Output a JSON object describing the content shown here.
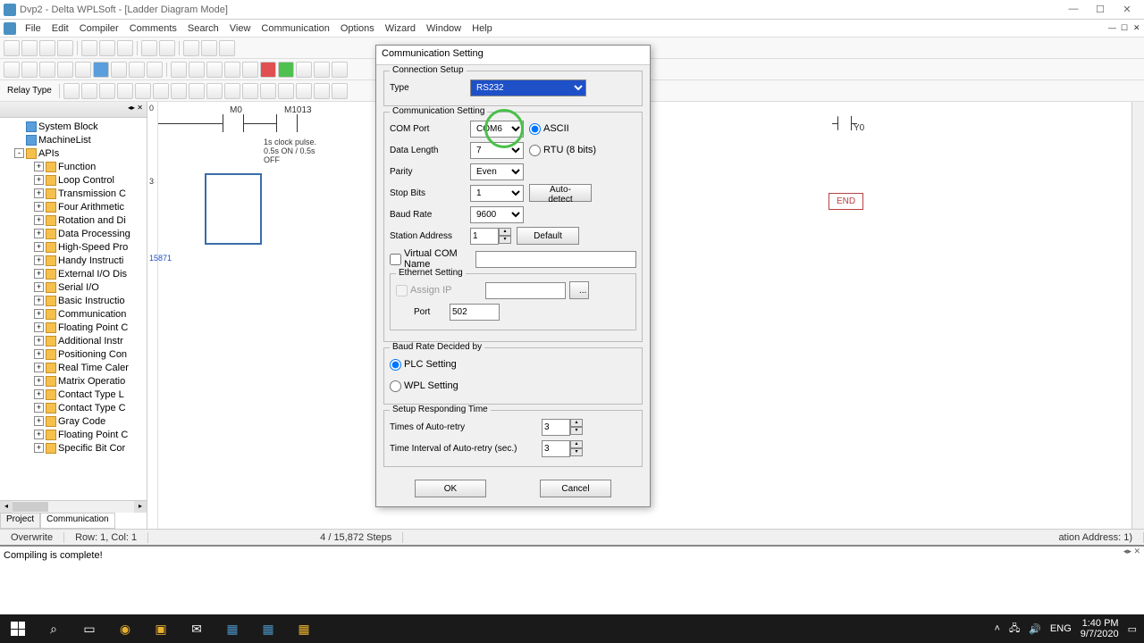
{
  "title": "Dvp2 - Delta WPLSoft - [Ladder Diagram Mode]",
  "menu": [
    "File",
    "Edit",
    "Compiler",
    "Comments",
    "Search",
    "View",
    "Communication",
    "Options",
    "Wizard",
    "Window",
    "Help"
  ],
  "sidebar": {
    "header": "Relay Type",
    "items": [
      {
        "label": "System Block",
        "lvl": 1,
        "icon": "blue"
      },
      {
        "label": "MachineList",
        "lvl": 1,
        "icon": "blue"
      },
      {
        "label": "APIs",
        "lvl": 1,
        "exp": "-"
      },
      {
        "label": "Function",
        "lvl": 2,
        "exp": "+"
      },
      {
        "label": "Loop Control",
        "lvl": 2,
        "exp": "+"
      },
      {
        "label": "Transmission C",
        "lvl": 2,
        "exp": "+"
      },
      {
        "label": "Four Arithmetic",
        "lvl": 2,
        "exp": "+"
      },
      {
        "label": "Rotation and Di",
        "lvl": 2,
        "exp": "+"
      },
      {
        "label": "Data Processing",
        "lvl": 2,
        "exp": "+"
      },
      {
        "label": "High-Speed Pro",
        "lvl": 2,
        "exp": "+"
      },
      {
        "label": "Handy Instructi",
        "lvl": 2,
        "exp": "+"
      },
      {
        "label": "External I/O Dis",
        "lvl": 2,
        "exp": "+"
      },
      {
        "label": "Serial I/O",
        "lvl": 2,
        "exp": "+"
      },
      {
        "label": "Basic Instructio",
        "lvl": 2,
        "exp": "+"
      },
      {
        "label": "Communication",
        "lvl": 2,
        "exp": "+"
      },
      {
        "label": "Floating Point C",
        "lvl": 2,
        "exp": "+"
      },
      {
        "label": "Additional Instr",
        "lvl": 2,
        "exp": "+"
      },
      {
        "label": "Positioning Con",
        "lvl": 2,
        "exp": "+"
      },
      {
        "label": "Real Time Caler",
        "lvl": 2,
        "exp": "+"
      },
      {
        "label": "Matrix Operatio",
        "lvl": 2,
        "exp": "+"
      },
      {
        "label": "Contact Type L",
        "lvl": 2,
        "exp": "+"
      },
      {
        "label": "Contact Type C",
        "lvl": 2,
        "exp": "+"
      },
      {
        "label": "Gray Code",
        "lvl": 2,
        "exp": "+"
      },
      {
        "label": "Floating Point C",
        "lvl": 2,
        "exp": "+"
      },
      {
        "label": "Specific Bit Cor",
        "lvl": 2,
        "exp": "+"
      }
    ],
    "tabs": [
      "Project",
      "Communication"
    ]
  },
  "canvas": {
    "step0": "0",
    "step3": "3",
    "step15871": "15871",
    "m0": "M0",
    "m1013": "M1013",
    "clock_text": "1s clock pulse.\n0.5s ON / 0.5s\nOFF",
    "y0": "Y0",
    "end": "END"
  },
  "status": {
    "overwrite": "Overwrite",
    "rowcol": "Row: 1, Col: 1",
    "steps": "4 / 15,872 Steps",
    "addr": "ation Address: 1)"
  },
  "output": "Compiling is complete!",
  "dialog": {
    "title": "Communication Setting",
    "conn_setup": "Connection Setup",
    "type_lbl": "Type",
    "type_val": "RS232",
    "comm_setting": "Communication Setting",
    "com_port_lbl": "COM Port",
    "com_port_val": "COM6",
    "ascii": "ASCII",
    "rtu": "RTU (8 bits)",
    "data_len_lbl": "Data Length",
    "data_len_val": "7",
    "parity_lbl": "Parity",
    "parity_val": "Even",
    "stop_lbl": "Stop Bits",
    "stop_val": "1",
    "auto_detect": "Auto-detect",
    "baud_lbl": "Baud Rate",
    "baud_val": "9600",
    "station_lbl": "Station Address",
    "station_val": "1",
    "default": "Default",
    "virtual_com": "Virtual COM Name",
    "eth_setting": "Ethernet Setting",
    "assign_ip": "Assign IP",
    "port_lbl": "Port",
    "port_val": "502",
    "baud_decided": "Baud Rate Decided by",
    "plc_setting": "PLC Setting",
    "wpl_setting": "WPL Setting",
    "resp_time": "Setup Responding Time",
    "retry_lbl": "Times of Auto-retry",
    "retry_val": "3",
    "interval_lbl": "Time Interval of Auto-retry (sec.)",
    "interval_val": "3",
    "ok": "OK",
    "cancel": "Cancel"
  },
  "taskbar": {
    "time": "1:40 PM",
    "date": "9/7/2020",
    "lang": "ENG"
  }
}
